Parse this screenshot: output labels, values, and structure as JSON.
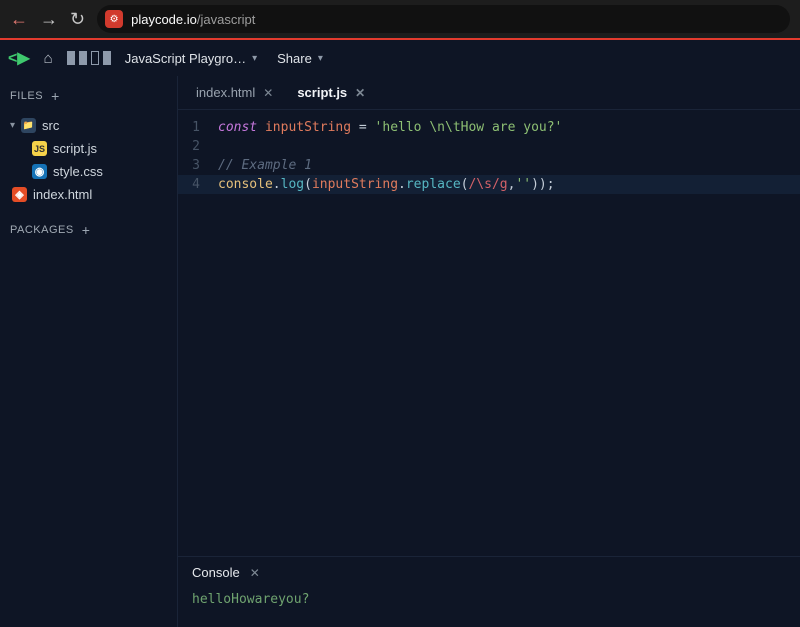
{
  "browser": {
    "url_host": "playcode.io",
    "url_path": "/javascript"
  },
  "appbar": {
    "project_label": "JavaScript Playgro…",
    "share_label": "Share"
  },
  "sidebar": {
    "files_header": "FILES",
    "packages_header": "PACKAGES",
    "tree": {
      "src": "src",
      "scriptjs": "script.js",
      "stylecss": "style.css",
      "indexhtml": "index.html"
    }
  },
  "tabs": [
    {
      "label": "index.html",
      "active": false
    },
    {
      "label": "script.js",
      "active": true
    }
  ],
  "code": {
    "lines": [
      "1",
      "2",
      "3",
      "4"
    ],
    "l1": {
      "kw": "const ",
      "var": "inputString",
      "op": " = ",
      "str": "'hello \\n\\tHow are you?'"
    },
    "l3_cmt": "// Example 1",
    "l4": {
      "obj": "console",
      "dot": ".",
      "fn": "log",
      "open": "(",
      "var": "inputString",
      "dot2": ".",
      "fn2": "replace",
      "open2": "(",
      "re": "/\\s/g",
      "comma": ",",
      "str": "''",
      "close": "));"
    }
  },
  "console": {
    "title": "Console",
    "output": "helloHowareyou?"
  }
}
